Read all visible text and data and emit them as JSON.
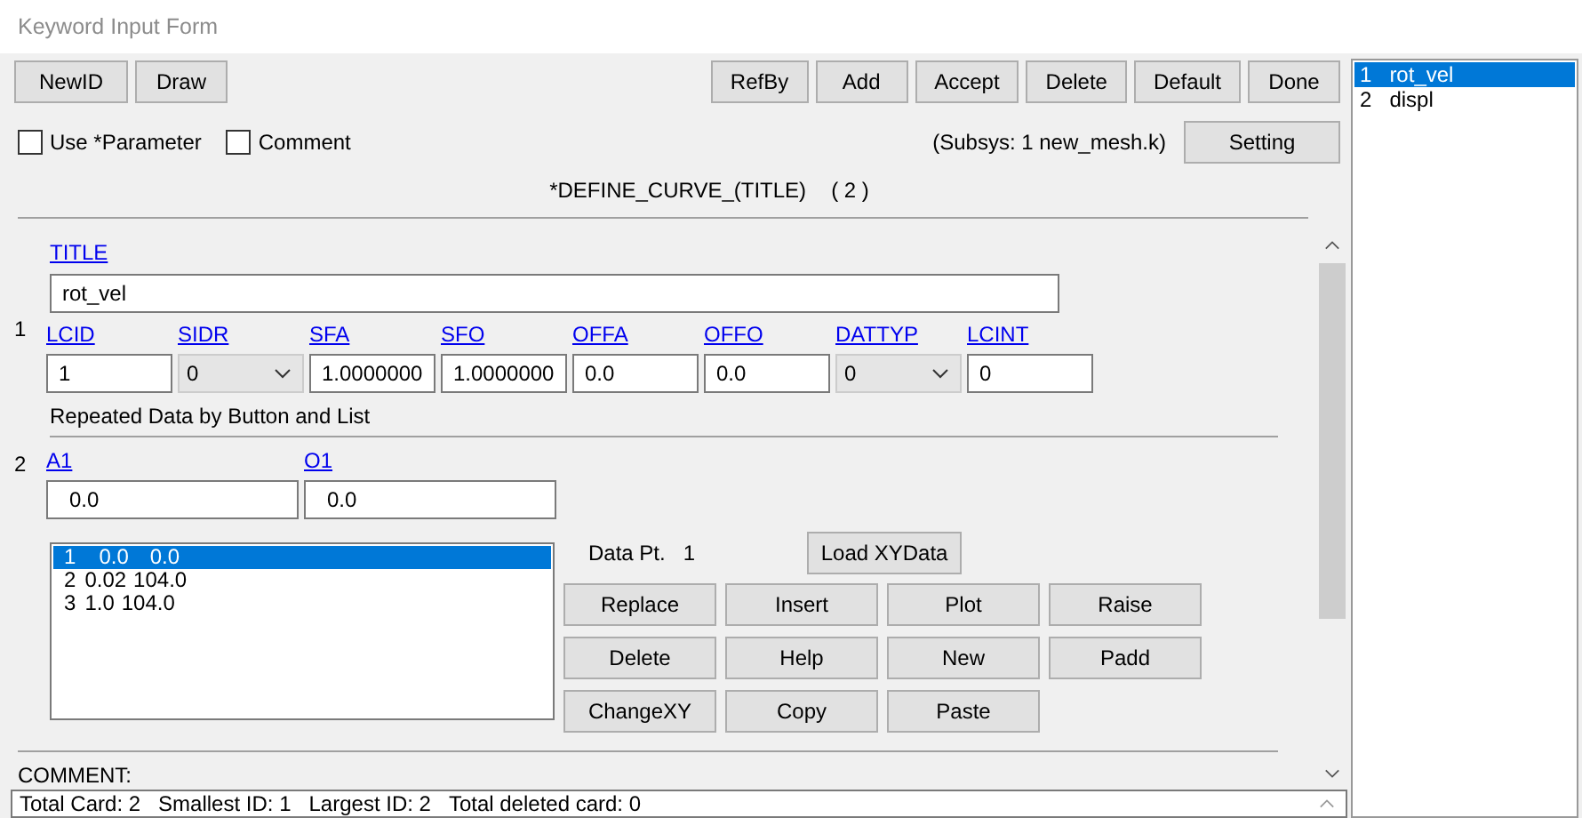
{
  "window": {
    "title": "Keyword Input Form"
  },
  "toolbar": {
    "left_buttons": [
      "NewID",
      "Draw"
    ],
    "right_buttons": [
      "RefBy",
      "Add",
      "Accept",
      "Delete",
      "Default",
      "Done"
    ]
  },
  "options": [
    {
      "label": "Use *Parameter",
      "checked": false
    },
    {
      "label": "Comment",
      "checked": false
    }
  ],
  "subsys": "(Subsys: 1 new_mesh.k)",
  "setting_button": "Setting",
  "keyword": {
    "name": "*DEFINE_CURVE_(TITLE)",
    "count": "( 2 )"
  },
  "title_card": {
    "label": "TITLE",
    "value": "rot_vel"
  },
  "card_1": {
    "number": "1",
    "fields": [
      {
        "label": "LCID",
        "value": "1",
        "kind": "text"
      },
      {
        "label": "SIDR",
        "value": "0",
        "kind": "select"
      },
      {
        "label": "SFA",
        "value": "1.0000000",
        "kind": "text"
      },
      {
        "label": "SFO",
        "value": "1.0000000",
        "kind": "text"
      },
      {
        "label": "OFFA",
        "value": "0.0",
        "kind": "text"
      },
      {
        "label": "OFFO",
        "value": "0.0",
        "kind": "text"
      },
      {
        "label": "DATTYP",
        "value": "0",
        "kind": "select"
      },
      {
        "label": "LCINT",
        "value": "0",
        "kind": "text"
      }
    ]
  },
  "repeated_label": "Repeated Data by Button and List",
  "card_2": {
    "number": "2",
    "fields": [
      {
        "label": "A1",
        "value": "0.0",
        "kind": "text"
      },
      {
        "label": "O1",
        "value": "0.0",
        "kind": "text"
      }
    ]
  },
  "data_list": [
    {
      "index": "1",
      "a": "0.0",
      "o": "0.0",
      "selected": true
    },
    {
      "index": "2",
      "a": "0.02",
      "o": "104.0",
      "selected": false
    },
    {
      "index": "3",
      "a": "1.0",
      "o": "104.0",
      "selected": false
    }
  ],
  "data_point": {
    "label": "Data Pt.",
    "value": "1"
  },
  "load_button": "Load XYData",
  "action_buttons": [
    "Replace",
    "Insert",
    "Plot",
    "Raise",
    "Delete",
    "Help",
    "New",
    "Padd",
    "ChangeXY",
    "Copy",
    "Paste"
  ],
  "comment_label": "COMMENT:",
  "status_bar": [
    "Total Card: 2",
    "Smallest ID: 1",
    "Largest ID: 2",
    "Total deleted card:  0"
  ],
  "keyword_list": [
    {
      "number": "1",
      "name": "rot_vel",
      "selected": true
    },
    {
      "number": "2",
      "name": "displ",
      "selected": false
    }
  ]
}
